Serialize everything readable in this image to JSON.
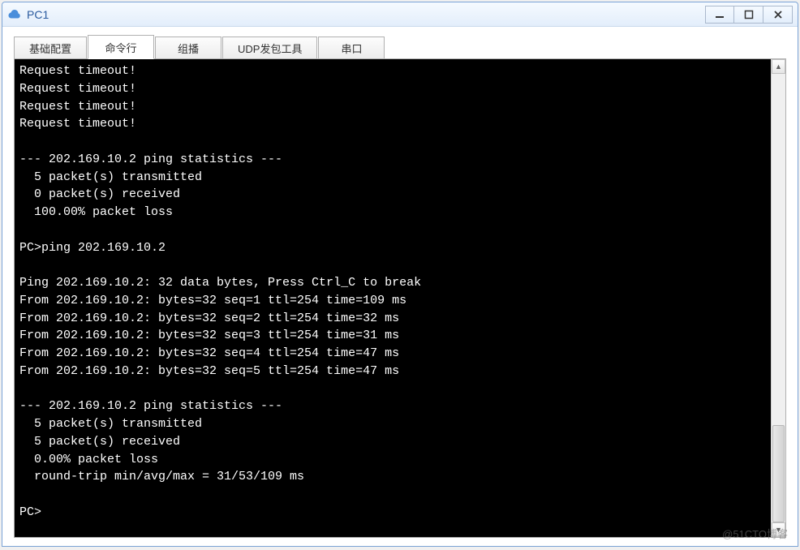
{
  "window": {
    "title": "PC1"
  },
  "tabs": [
    {
      "label": "基础配置",
      "active": false
    },
    {
      "label": "命令行",
      "active": true
    },
    {
      "label": "组播",
      "active": false
    },
    {
      "label": "UDP发包工具",
      "active": false
    },
    {
      "label": "串口",
      "active": false
    }
  ],
  "terminal": {
    "lines": [
      "Request timeout!",
      "Request timeout!",
      "Request timeout!",
      "Request timeout!",
      "",
      "--- 202.169.10.2 ping statistics ---",
      "  5 packet(s) transmitted",
      "  0 packet(s) received",
      "  100.00% packet loss",
      "",
      "PC>ping 202.169.10.2",
      "",
      "Ping 202.169.10.2: 32 data bytes, Press Ctrl_C to break",
      "From 202.169.10.2: bytes=32 seq=1 ttl=254 time=109 ms",
      "From 202.169.10.2: bytes=32 seq=2 ttl=254 time=32 ms",
      "From 202.169.10.2: bytes=32 seq=3 ttl=254 time=31 ms",
      "From 202.169.10.2: bytes=32 seq=4 ttl=254 time=47 ms",
      "From 202.169.10.2: bytes=32 seq=5 ttl=254 time=47 ms",
      "",
      "--- 202.169.10.2 ping statistics ---",
      "  5 packet(s) transmitted",
      "  5 packet(s) received",
      "  0.00% packet loss",
      "  round-trip min/avg/max = 31/53/109 ms",
      "",
      "PC>"
    ]
  },
  "watermark": "@51CTO博客"
}
